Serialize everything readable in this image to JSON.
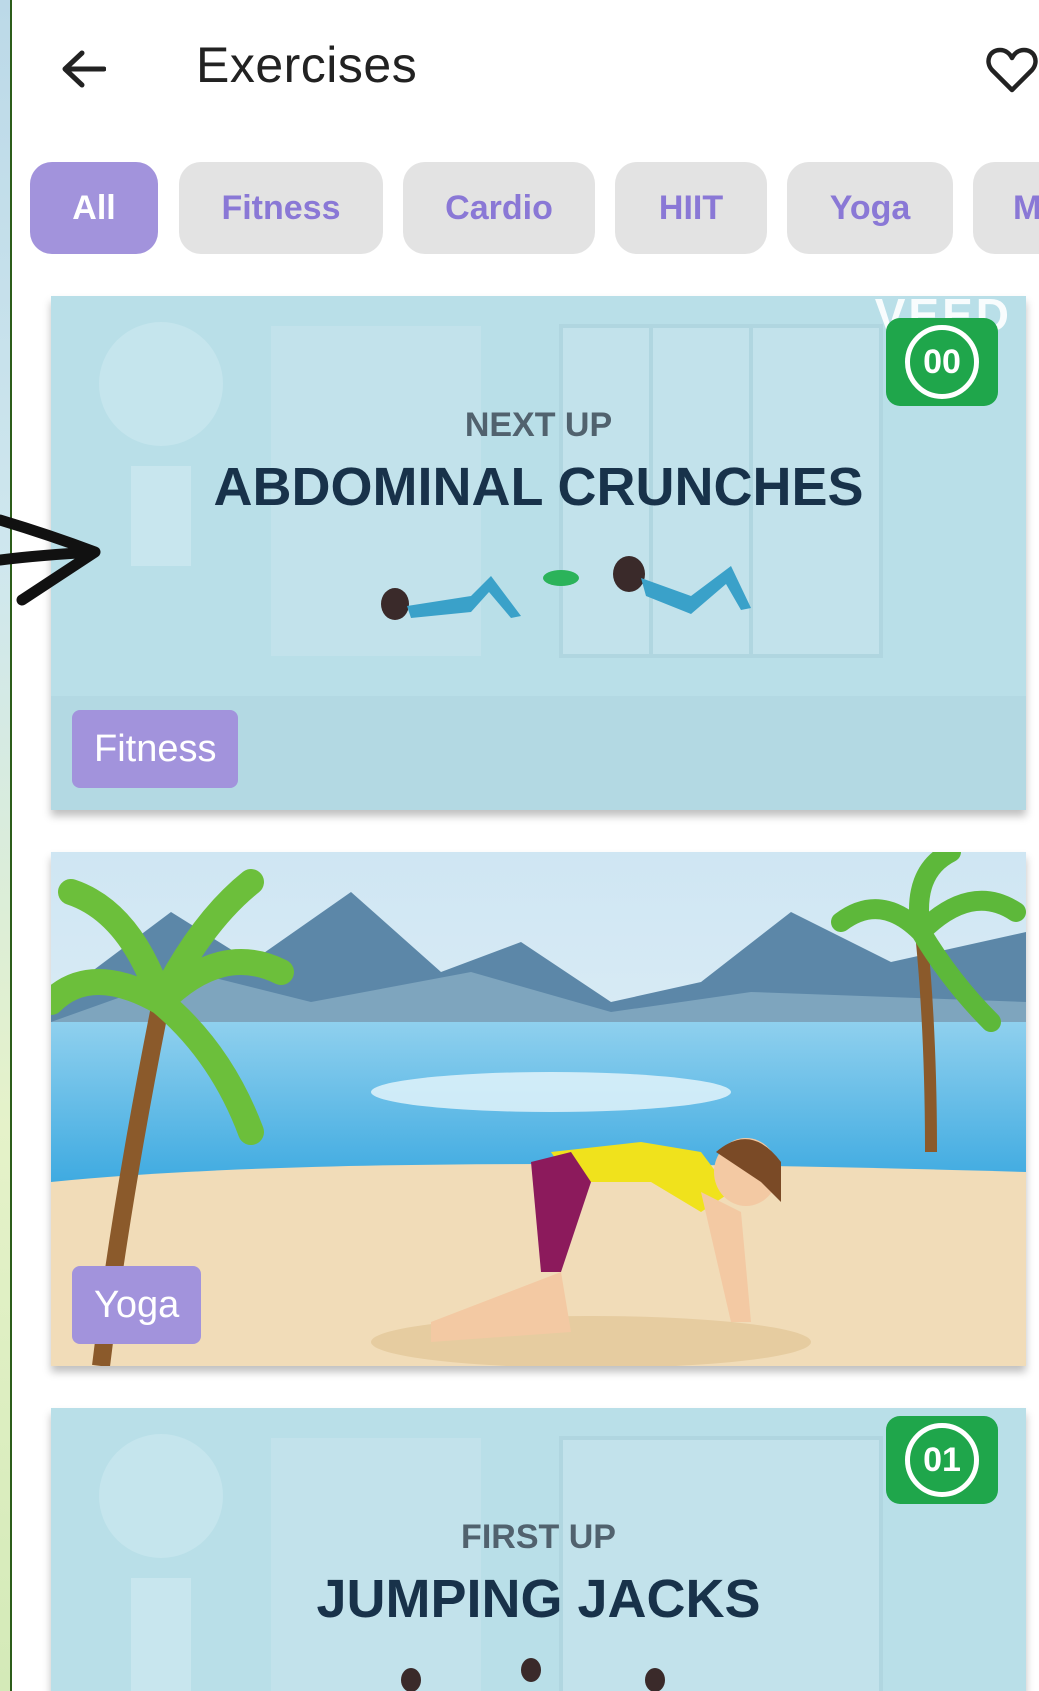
{
  "header": {
    "title": "Exercises"
  },
  "filters": [
    {
      "label": "All",
      "active": true
    },
    {
      "label": "Fitness",
      "active": false
    },
    {
      "label": "Cardio",
      "active": false
    },
    {
      "label": "HIIT",
      "active": false
    },
    {
      "label": "Yoga",
      "active": false
    },
    {
      "label": "M",
      "active": false
    }
  ],
  "cards": [
    {
      "subtitle": "NEXT UP",
      "headline": "ABDOMINAL CRUNCHES",
      "counter": "00",
      "watermark": "VEED",
      "tag": "Fitness"
    },
    {
      "tag": "Yoga"
    },
    {
      "subtitle": "FIRST UP",
      "headline": "JUMPING JACKS",
      "counter": "01"
    }
  ],
  "colors": {
    "accent": "#a293dc",
    "accent_text": "#8a78d6",
    "chip_bg": "#e3e3e3",
    "counter_green": "#1fa64b",
    "card_bg": "#b6dde7"
  }
}
